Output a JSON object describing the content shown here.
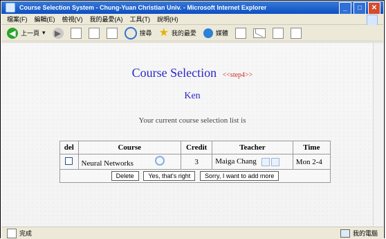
{
  "window": {
    "title": "Course Selection System - Chung-Yuan Christian Univ. - Microsoft Internet Explorer",
    "controls": {
      "minimize": "_",
      "maximize": "□",
      "close": "✕"
    }
  },
  "menu": {
    "items": [
      "檔案(F)",
      "編輯(E)",
      "檢視(V)",
      "我的最愛(A)",
      "工具(T)",
      "說明(H)"
    ]
  },
  "toolbar": {
    "back_label": "上一頁",
    "search_label": "搜尋",
    "favorites_label": "我的最愛",
    "media_label": "媒體"
  },
  "page": {
    "title": "Course Selection",
    "step_badge": "<<step4>>",
    "student_name": "Ken",
    "intro_text": "Your current course selection list is",
    "table": {
      "headers": [
        "del",
        "Course",
        "Credit",
        "Teacher",
        "Time"
      ],
      "rows": [
        {
          "course": "Neural Networks",
          "credit": "3",
          "teacher": "Maiga Chang",
          "time": "Mon 2-4"
        }
      ]
    },
    "actions": {
      "delete": "Delete",
      "confirm": "Yes, that's right",
      "add": "Sorry, I want to add more"
    }
  },
  "status": {
    "left_text": "完成",
    "right_text": "我的電腦"
  },
  "colors": {
    "title_gradient_top": "#3a7bd5",
    "title_gradient_bottom": "#0b4fc4",
    "heading": "#2a27c7",
    "step": "#cc2a2a",
    "chrome": "#ece9d8"
  }
}
